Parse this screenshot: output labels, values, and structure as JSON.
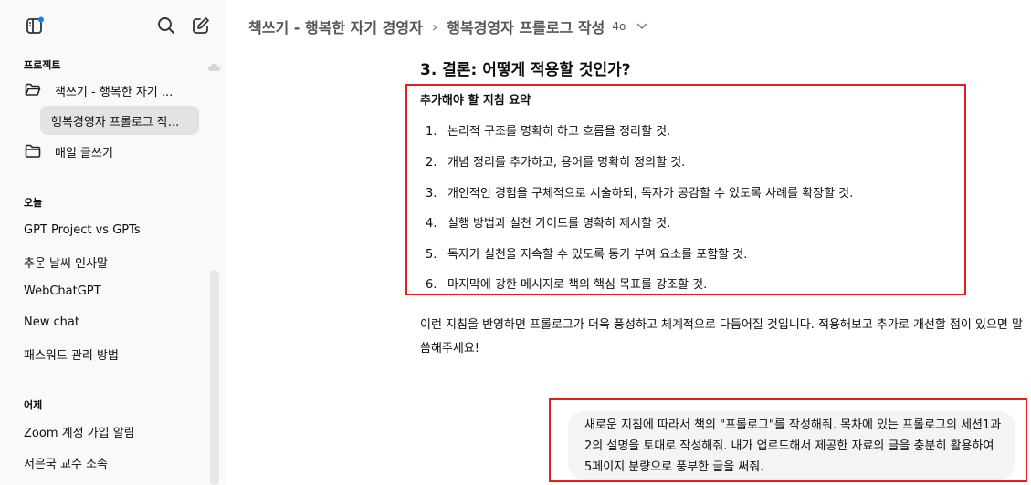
{
  "sidebar": {
    "projects_label": "프로젝트",
    "projects": [
      {
        "label": "책쓰기 - 행복한 자기 ..."
      },
      {
        "label": "매일 글쓰기"
      }
    ],
    "active_chat": "행복경영자 프롤로그 작...",
    "sections": [
      {
        "label": "오늘",
        "items": [
          "GPT Project vs GPTs",
          "추운 날씨 인사말",
          "WebChatGPT",
          "New chat",
          "패스워드 관리 방법"
        ]
      },
      {
        "label": "어제",
        "items": [
          "Zoom 계정 가입 알림",
          "서은국 교수 소속"
        ]
      }
    ]
  },
  "header": {
    "project": "책쓰기 - 행복한 자기 경영자",
    "separator": "›",
    "chat": "행복경영자 프롤로그 작성",
    "model": "4o"
  },
  "message": {
    "heading": "3. 결론: 어떻게 적용할 것인가?",
    "summary_title": "추가해야 할 지침 요약",
    "items": [
      {
        "num": "1.",
        "text": "논리적 구조를 명확히 하고 흐름을 정리할 것."
      },
      {
        "num": "2.",
        "text": "개념 정리를 추가하고, 용어를 명확히 정의할 것."
      },
      {
        "num": "3.",
        "text": "개인적인 경험을 구체적으로 서술하되, 독자가 공감할 수 있도록 사례를 확장할 것."
      },
      {
        "num": "4.",
        "text": "실행 방법과 실천 가이드를 명확히 제시할 것."
      },
      {
        "num": "5.",
        "text": "독자가 실천을 지속할 수 있도록 동기 부여 요소를 포함할 것."
      },
      {
        "num": "6.",
        "text": "마지막에 강한 메시지로 책의 핵심 목표를 강조할 것."
      }
    ],
    "closing": "이런 지침을 반영하면 프롤로그가 더욱 풍성하고 체계적으로 다듬어질 것입니다. 적용해보고 추가로 개선할 점이 있으면 말씀해주세요!"
  },
  "user_message": {
    "text": "새로운 지침에 따라서 책의 \"프롤로그\"를 작성해줘. 목차에 있는 프롤로그의 세션1과 2의 설명을 토대로 작성해줘. 내가 업로드해서 제공한 자료의 글을 충분히 활용하여 5페이지 분량으로 풍부한 글을 써줘."
  },
  "colors": {
    "highlight_border": "#e0201d",
    "sidebar_bg": "#f9f9f9",
    "active_bg": "#e3e3e3",
    "bubble_bg": "#f4f4f4",
    "notify_dot": "#0285ff"
  }
}
